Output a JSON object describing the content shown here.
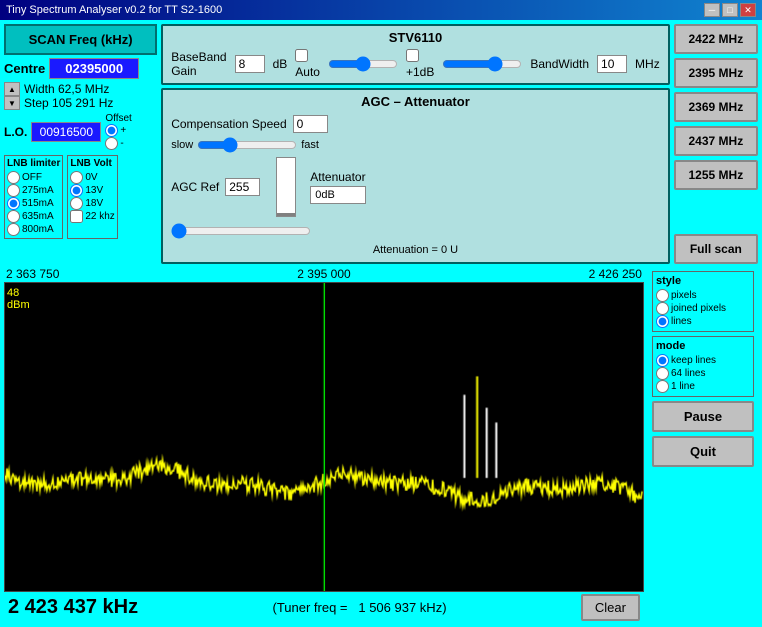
{
  "titleBar": {
    "title": "Tiny Spectrum Analyser v0.2 for TT S2-1600",
    "minimizeLabel": "─",
    "maximizeLabel": "□",
    "closeLabel": "✕"
  },
  "leftPanel": {
    "scanBtn": "SCAN Freq (kHz)",
    "centreLabel": "Centre",
    "centreValue": "02395000",
    "widthLabel": "Width  62,5 MHz",
    "stepLabel": "Step  105 291 Hz",
    "loLabel": "L.O.",
    "loValue": "00916500",
    "offsetLabel": "Offset",
    "offsetPlus": "+",
    "offsetMinus": "-",
    "lnbLimiterTitle": "LNB limiter",
    "lnbOptions": [
      "OFF",
      "275mA",
      "515mA",
      "635mA",
      "800mA"
    ],
    "lnbVoltTitle": "LNB Volt",
    "lnbVoltOptions": [
      "0V",
      "13V",
      "18V"
    ],
    "checkbox22khz": "22 khz"
  },
  "basebandBox": {
    "title": "STV6110",
    "basebandGainLabel": "BaseBand Gain",
    "basebandGainValue": "8",
    "dbLabel": "dB",
    "autoLabel": "Auto",
    "plus1dbLabel": "+1dB",
    "bandwidthLabel": "BandWidth",
    "bandwidthValue": "10",
    "mhzLabel": "MHz"
  },
  "agcBox": {
    "title": "AGC – Attenuator",
    "compensationLabel": "Compensation Speed",
    "compensationValue": "0",
    "slowLabel": "slow",
    "fastLabel": "fast",
    "agcRefLabel": "AGC Ref",
    "agcRefValue": "255",
    "attenuatorLabel": "Attenuator",
    "attenuatorValue": "0dB",
    "attenuationLabel": "Attenuation =  0 U"
  },
  "freqButtons": [
    "2422 MHz",
    "2395 MHz",
    "2369 MHz",
    "2437 MHz",
    "1255 MHz"
  ],
  "fullScanBtn": "Full scan",
  "spectrum": {
    "freqLeft": "2 363 750",
    "freqCenter": "2 395 000",
    "freqRight": "2 426 250",
    "dbmLabel": "48\ndBm"
  },
  "bottomBar": {
    "currentFreq": "2 423 437 kHz",
    "tunerFreqLabel": "(Tuner freq =",
    "tunerFreqValue": "1 506 937 kHz)",
    "clearBtn": "Clear"
  },
  "rightControls": {
    "styleLabel": "style",
    "styleOptions": [
      "pixels",
      "joined pixels",
      "lines"
    ],
    "styleSelected": "lines",
    "modeLabel": "mode",
    "modeOptions": [
      "keep lines",
      "64 lines",
      "1 line"
    ],
    "modeSelected": "keep lines",
    "pauseBtn": "Pause",
    "quitBtn": "Quit"
  }
}
